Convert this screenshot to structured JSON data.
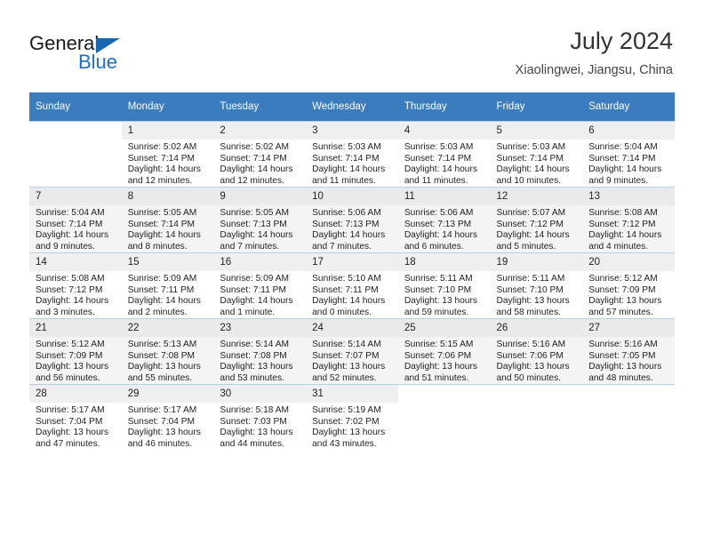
{
  "brand": {
    "name_part1": "General",
    "name_part2": "Blue",
    "accent_color": "#1668b3"
  },
  "header": {
    "title": "July 2024",
    "location": "Xiaolingwei, Jiangsu, China"
  },
  "calendar": {
    "header_bg": "#3b7cbf",
    "weekday_headers": [
      "Sunday",
      "Monday",
      "Tuesday",
      "Wednesday",
      "Thursday",
      "Friday",
      "Saturday"
    ],
    "weeks": [
      {
        "shaded": false,
        "days": [
          {
            "num": "",
            "detail": ""
          },
          {
            "num": "1",
            "detail": "Sunrise: 5:02 AM\nSunset: 7:14 PM\nDaylight: 14 hours\nand 12 minutes."
          },
          {
            "num": "2",
            "detail": "Sunrise: 5:02 AM\nSunset: 7:14 PM\nDaylight: 14 hours\nand 12 minutes."
          },
          {
            "num": "3",
            "detail": "Sunrise: 5:03 AM\nSunset: 7:14 PM\nDaylight: 14 hours\nand 11 minutes."
          },
          {
            "num": "4",
            "detail": "Sunrise: 5:03 AM\nSunset: 7:14 PM\nDaylight: 14 hours\nand 11 minutes."
          },
          {
            "num": "5",
            "detail": "Sunrise: 5:03 AM\nSunset: 7:14 PM\nDaylight: 14 hours\nand 10 minutes."
          },
          {
            "num": "6",
            "detail": "Sunrise: 5:04 AM\nSunset: 7:14 PM\nDaylight: 14 hours\nand 9 minutes."
          }
        ]
      },
      {
        "shaded": true,
        "days": [
          {
            "num": "7",
            "detail": "Sunrise: 5:04 AM\nSunset: 7:14 PM\nDaylight: 14 hours\nand 9 minutes."
          },
          {
            "num": "8",
            "detail": "Sunrise: 5:05 AM\nSunset: 7:14 PM\nDaylight: 14 hours\nand 8 minutes."
          },
          {
            "num": "9",
            "detail": "Sunrise: 5:05 AM\nSunset: 7:13 PM\nDaylight: 14 hours\nand 7 minutes."
          },
          {
            "num": "10",
            "detail": "Sunrise: 5:06 AM\nSunset: 7:13 PM\nDaylight: 14 hours\nand 7 minutes."
          },
          {
            "num": "11",
            "detail": "Sunrise: 5:06 AM\nSunset: 7:13 PM\nDaylight: 14 hours\nand 6 minutes."
          },
          {
            "num": "12",
            "detail": "Sunrise: 5:07 AM\nSunset: 7:12 PM\nDaylight: 14 hours\nand 5 minutes."
          },
          {
            "num": "13",
            "detail": "Sunrise: 5:08 AM\nSunset: 7:12 PM\nDaylight: 14 hours\nand 4 minutes."
          }
        ]
      },
      {
        "shaded": false,
        "days": [
          {
            "num": "14",
            "detail": "Sunrise: 5:08 AM\nSunset: 7:12 PM\nDaylight: 14 hours\nand 3 minutes."
          },
          {
            "num": "15",
            "detail": "Sunrise: 5:09 AM\nSunset: 7:11 PM\nDaylight: 14 hours\nand 2 minutes."
          },
          {
            "num": "16",
            "detail": "Sunrise: 5:09 AM\nSunset: 7:11 PM\nDaylight: 14 hours\nand 1 minute."
          },
          {
            "num": "17",
            "detail": "Sunrise: 5:10 AM\nSunset: 7:11 PM\nDaylight: 14 hours\nand 0 minutes."
          },
          {
            "num": "18",
            "detail": "Sunrise: 5:11 AM\nSunset: 7:10 PM\nDaylight: 13 hours\nand 59 minutes."
          },
          {
            "num": "19",
            "detail": "Sunrise: 5:11 AM\nSunset: 7:10 PM\nDaylight: 13 hours\nand 58 minutes."
          },
          {
            "num": "20",
            "detail": "Sunrise: 5:12 AM\nSunset: 7:09 PM\nDaylight: 13 hours\nand 57 minutes."
          }
        ]
      },
      {
        "shaded": true,
        "days": [
          {
            "num": "21",
            "detail": "Sunrise: 5:12 AM\nSunset: 7:09 PM\nDaylight: 13 hours\nand 56 minutes."
          },
          {
            "num": "22",
            "detail": "Sunrise: 5:13 AM\nSunset: 7:08 PM\nDaylight: 13 hours\nand 55 minutes."
          },
          {
            "num": "23",
            "detail": "Sunrise: 5:14 AM\nSunset: 7:08 PM\nDaylight: 13 hours\nand 53 minutes."
          },
          {
            "num": "24",
            "detail": "Sunrise: 5:14 AM\nSunset: 7:07 PM\nDaylight: 13 hours\nand 52 minutes."
          },
          {
            "num": "25",
            "detail": "Sunrise: 5:15 AM\nSunset: 7:06 PM\nDaylight: 13 hours\nand 51 minutes."
          },
          {
            "num": "26",
            "detail": "Sunrise: 5:16 AM\nSunset: 7:06 PM\nDaylight: 13 hours\nand 50 minutes."
          },
          {
            "num": "27",
            "detail": "Sunrise: 5:16 AM\nSunset: 7:05 PM\nDaylight: 13 hours\nand 48 minutes."
          }
        ]
      },
      {
        "shaded": false,
        "days": [
          {
            "num": "28",
            "detail": "Sunrise: 5:17 AM\nSunset: 7:04 PM\nDaylight: 13 hours\nand 47 minutes."
          },
          {
            "num": "29",
            "detail": "Sunrise: 5:17 AM\nSunset: 7:04 PM\nDaylight: 13 hours\nand 46 minutes."
          },
          {
            "num": "30",
            "detail": "Sunrise: 5:18 AM\nSunset: 7:03 PM\nDaylight: 13 hours\nand 44 minutes."
          },
          {
            "num": "31",
            "detail": "Sunrise: 5:19 AM\nSunset: 7:02 PM\nDaylight: 13 hours\nand 43 minutes."
          },
          {
            "num": "",
            "detail": ""
          },
          {
            "num": "",
            "detail": ""
          },
          {
            "num": "",
            "detail": ""
          }
        ]
      }
    ]
  }
}
